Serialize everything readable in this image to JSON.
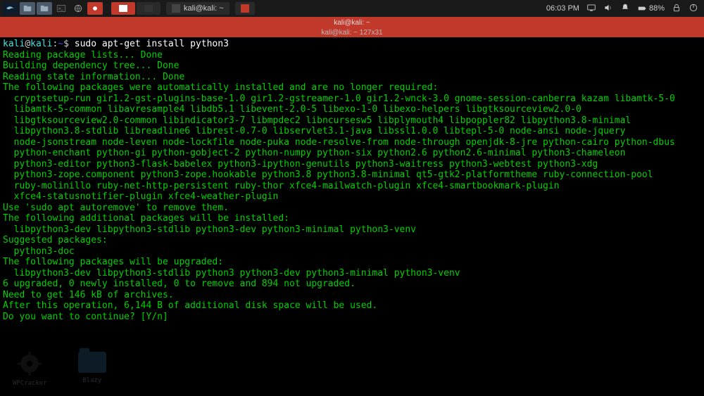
{
  "taskbar": {
    "task_label": "kali@kali: ~",
    "clock": "06:03 PM",
    "battery": "88%"
  },
  "window": {
    "title_top": "kali@kali: ~",
    "title_sub": "kali@kali: ~ 127x31"
  },
  "desktop": {
    "icon1": "WPCracker",
    "icon2": "Blazy"
  },
  "term": {
    "prompt_user": "kali",
    "prompt_at": "@",
    "prompt_host": "kali",
    "prompt_colon": ":",
    "prompt_path": "~",
    "prompt_dollar": "$ ",
    "command": "sudo apt-get install python3",
    "l1": "Reading package lists... Done",
    "l2": "Building dependency tree... Done",
    "l3": "Reading state information... Done",
    "l4": "The following packages were automatically installed and are no longer required:",
    "pkg1": "  cryptsetup-run gir1.2-gst-plugins-base-1.0 gir1.2-gstreamer-1.0 gir1.2-wnck-3.0 gnome-session-canberra kazam libamtk-5-0",
    "pkg2": "  libamtk-5-common libavresample4 libdb5.1 libevent-2.0-5 libexo-1-0 libexo-helpers libgtksourceview2.0-0",
    "pkg3": "  libgtksourceview2.0-common libindicator3-7 libmpdec2 libncursesw5 libplymouth4 libpoppler82 libpython3.8-minimal",
    "pkg4": "  libpython3.8-stdlib libreadline6 librest-0.7-0 libservlet3.1-java libssl1.0.0 libtepl-5-0 node-ansi node-jquery",
    "pkg5": "  node-jsonstream node-leven node-lockfile node-puka node-resolve-from node-through openjdk-8-jre python-cairo python-dbus",
    "pkg6": "  python-enchant python-gi python-gobject-2 python-numpy python-six python2.6 python2.6-minimal python3-chameleon",
    "pkg7": "  python3-editor python3-flask-babelex python3-ipython-genutils python3-waitress python3-webtest python3-xdg",
    "pkg8": "  python3-zope.component python3-zope.hookable python3.8 python3.8-minimal qt5-gtk2-platformtheme ruby-connection-pool",
    "pkg9": "  ruby-molinillo ruby-net-http-persistent ruby-thor xfce4-mailwatch-plugin xfce4-smartbookmark-plugin",
    "pkg10": "  xfce4-statusnotifier-plugin xfce4-weather-plugin",
    "l5": "Use 'sudo apt autoremove' to remove them.",
    "l6": "The following additional packages will be installed:",
    "add1": "  libpython3-dev libpython3-stdlib python3-dev python3-minimal python3-venv",
    "l7": "Suggested packages:",
    "sug1": "  python3-doc",
    "l8": "The following packages will be upgraded:",
    "upg1": "  libpython3-dev libpython3-stdlib python3 python3-dev python3-minimal python3-venv",
    "l9": "6 upgraded, 0 newly installed, 0 to remove and 894 not upgraded.",
    "l10": "Need to get 146 kB of archives.",
    "l11": "After this operation, 6,144 B of additional disk space will be used.",
    "l12": "Do you want to continue? [Y/n]"
  }
}
